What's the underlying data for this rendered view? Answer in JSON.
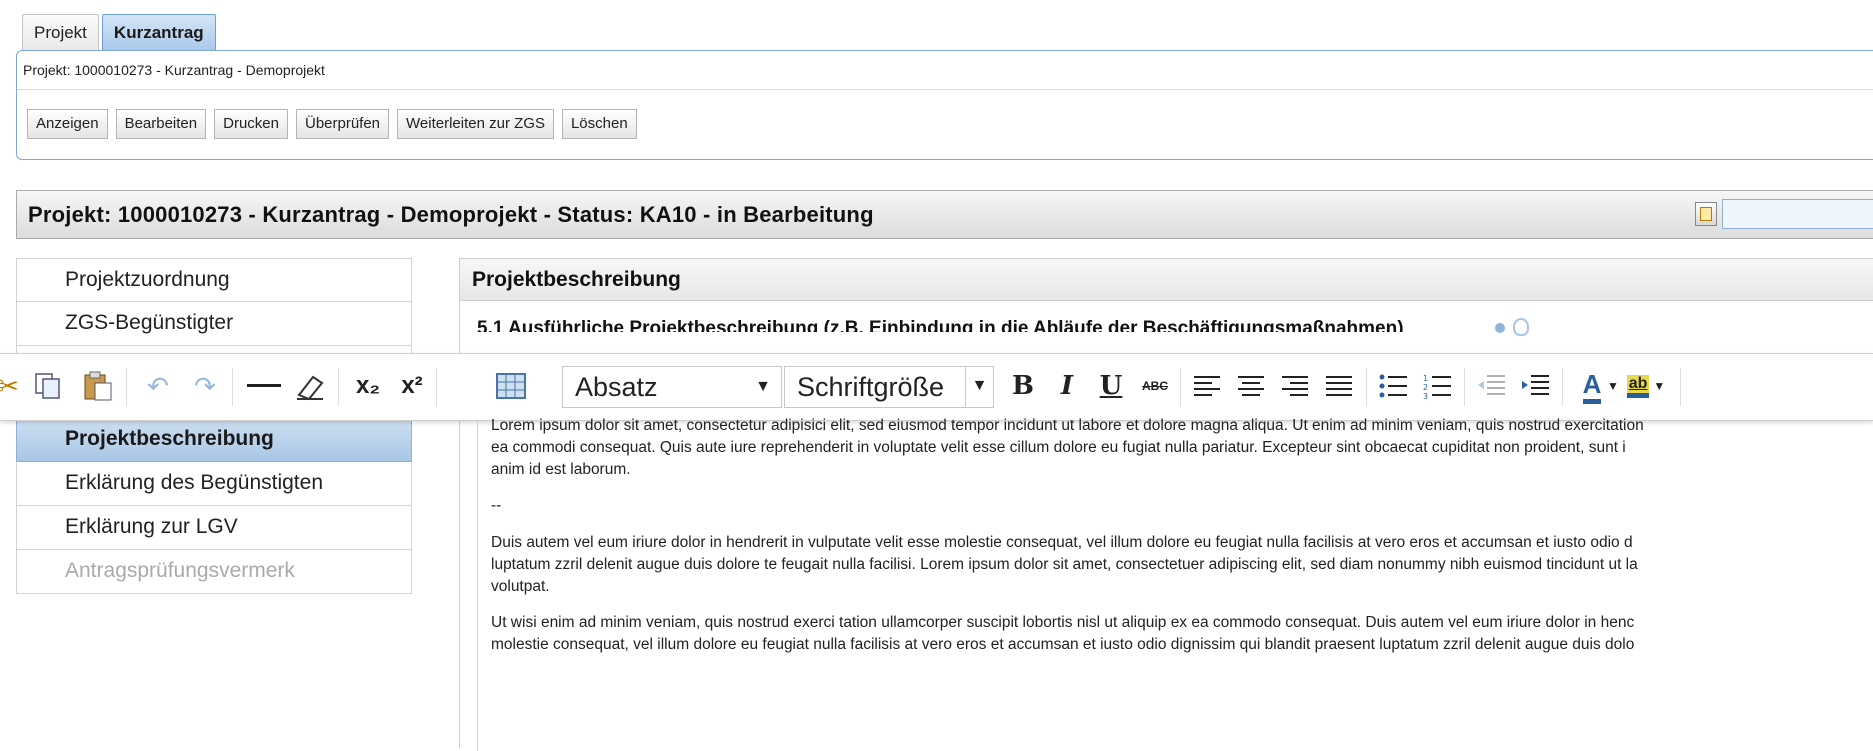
{
  "tabs": [
    {
      "label": "Projekt",
      "active": false
    },
    {
      "label": "Kurzantrag",
      "active": true
    }
  ],
  "breadcrumb": "Projekt: 1000010273 - Kurzantrag - Demoprojekt",
  "actions": {
    "anzeigen": "Anzeigen",
    "bearbeiten": "Bearbeiten",
    "drucken": "Drucken",
    "ueberpruefen": "Überprüfen",
    "weiterleiten": "Weiterleiten zur ZGS",
    "loeschen": "Löschen"
  },
  "page_title": "Projekt: 1000010273 - Kurzantrag - Demoprojekt - Status: KA10 - in Bearbeitung",
  "sidebar": {
    "items": [
      {
        "label": "Projektzuordnung",
        "state": "normal"
      },
      {
        "label": "ZGS-Begünstigter",
        "state": "normal"
      },
      {
        "label": "Projektbeschreibung",
        "state": "active"
      },
      {
        "label": "Erklärung des Begünstigten",
        "state": "normal"
      },
      {
        "label": "Erklärung zur LGV",
        "state": "normal"
      },
      {
        "label": "Antragsprüfungsvermerk",
        "state": "disabled"
      }
    ]
  },
  "section": {
    "title": "Projektbeschreibung",
    "question": "5.1 Ausführliche Projektbeschreibung (z.B. Einbindung in die Abläufe der Beschäftigungsmaßnahmen)"
  },
  "editor_toolbar": {
    "format_select": "Absatz",
    "size_select": "Schriftgröße",
    "bold_glyph": "B",
    "italic_glyph": "I",
    "underline_glyph": "U",
    "strike_glyph": "ABC",
    "highlight_glyph": "ab",
    "font_color_glyph": "A",
    "subscript_glyph": "x₂",
    "superscript_glyph": "x²"
  },
  "editor": {
    "lines": [
      "Lorem ipsum dolor sit amet, consectetur adipisici elit, sed eiusmod tempor incidunt ut labore et dolore magna aliqua. Ut enim ad minim veniam, quis nostrud exercitation",
      "ea commodi consequat. Quis aute iure reprehenderit in voluptate velit esse cillum dolore eu fugiat nulla pariatur. Excepteur sint obcaecat cupiditat non proident, sunt i",
      "anim id est laborum.",
      "--",
      "Duis autem vel eum iriure dolor in hendrerit in vulputate velit esse molestie consequat, vel illum dolore eu feugiat nulla facilisis at vero eros et accumsan et iusto odio d",
      "luptatum zzril delenit augue duis dolore te feugait nulla facilisi. Lorem ipsum dolor sit amet, consectetuer adipiscing elit, sed diam nonummy nibh euismod tincidunt ut la",
      "volutpat.",
      "Ut wisi enim ad minim veniam, quis nostrud exerci tation ullamcorper suscipit lobortis nisl ut aliquip ex ea commodo consequat. Duis autem vel eum iriure dolor in henc",
      "molestie consequat, vel illum dolore eu feugiat nulla facilisis at vero eros et accumsan et iusto odio dignissim qui blandit praesent luptatum zzril delenit augue duis dolo"
    ]
  }
}
